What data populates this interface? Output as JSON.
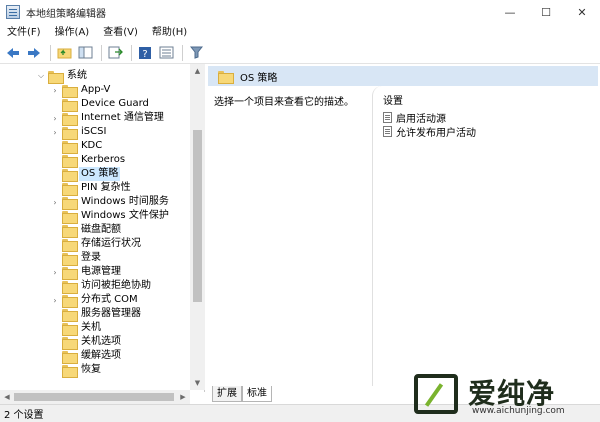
{
  "window": {
    "title": "本地组策略编辑器",
    "minimize": "—",
    "maximize": "☐",
    "close": "✕"
  },
  "menu": [
    "文件(F)",
    "操作(A)",
    "查看(V)",
    "帮助(H)"
  ],
  "toolbar": [
    "back-icon",
    "forward-icon",
    "up-folder-icon",
    "show-tree-icon",
    "export-icon",
    "help-icon",
    "properties-icon",
    "filter-icon"
  ],
  "tree": {
    "items": [
      {
        "label": "系统",
        "expanded": true
      },
      {
        "label": "App-V",
        "has_children": true
      },
      {
        "label": "Device Guard",
        "has_children": false
      },
      {
        "label": "Internet 通信管理",
        "has_children": true
      },
      {
        "label": "iSCSI",
        "has_children": true
      },
      {
        "label": "KDC",
        "has_children": false
      },
      {
        "label": "Kerberos",
        "has_children": false
      },
      {
        "label": "OS 策略",
        "has_children": false,
        "selected": true
      },
      {
        "label": "PIN 复杂性",
        "has_children": false
      },
      {
        "label": "Windows 时间服务",
        "has_children": true
      },
      {
        "label": "Windows 文件保护",
        "has_children": false
      },
      {
        "label": "磁盘配额",
        "has_children": false
      },
      {
        "label": "存储运行状况",
        "has_children": false
      },
      {
        "label": "登录",
        "has_children": false
      },
      {
        "label": "电源管理",
        "has_children": true
      },
      {
        "label": "访问被拒绝协助",
        "has_children": false
      },
      {
        "label": "分布式 COM",
        "has_children": true
      },
      {
        "label": "服务器管理器",
        "has_children": false
      },
      {
        "label": "关机",
        "has_children": false
      },
      {
        "label": "关机选项",
        "has_children": false
      },
      {
        "label": "缓解选项",
        "has_children": false
      },
      {
        "label": "恢复",
        "has_children": false
      }
    ]
  },
  "main": {
    "header_title": "OS 策略",
    "description": "选择一个项目来查看它的描述。",
    "settings_header": "设置",
    "settings": [
      "启用活动源",
      "允许发布用户活动"
    ],
    "tabs": [
      "扩展",
      "标准"
    ]
  },
  "status": "2 个设置",
  "watermark": {
    "text": "爱纯净",
    "url": "www.aichunjing.com"
  }
}
